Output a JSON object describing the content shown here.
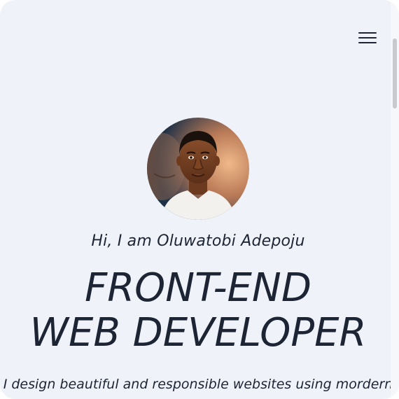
{
  "header": {
    "menu_icon": "hamburger-menu-icon"
  },
  "hero": {
    "avatar_alt": "Oluwatobi Adepoju",
    "greeting": "Hi, I am Oluwatobi Adepoju",
    "title_line_1": "FRONT-END",
    "title_line_2": "WEB DEVELOPER",
    "tagline": "I design beautiful and responsible websites using mordern"
  },
  "colors": {
    "background": "#eff3f9",
    "text": "#1d2433",
    "avatar_bg_dark": "#1f3147",
    "avatar_bg_light": "#e8a878"
  }
}
